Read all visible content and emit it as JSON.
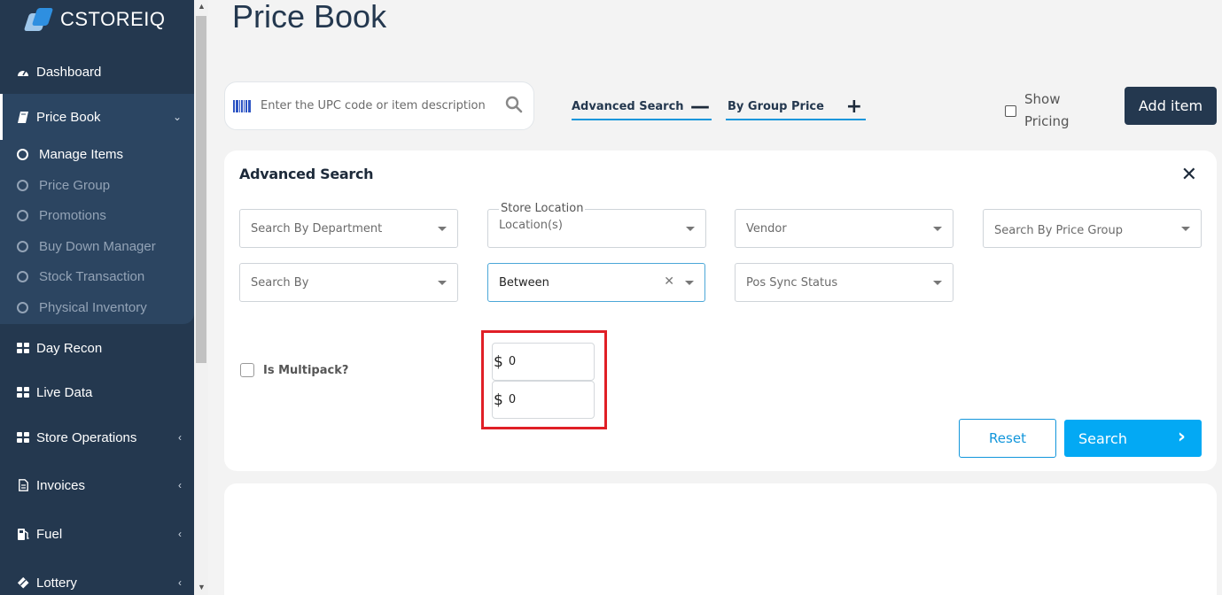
{
  "brand": {
    "name": "CSTOREIQ"
  },
  "sidebar": {
    "items": [
      {
        "label": "Dashboard"
      },
      {
        "label": "Price Book"
      },
      {
        "label": "Day Recon"
      },
      {
        "label": "Live Data"
      },
      {
        "label": "Store Operations"
      },
      {
        "label": "Invoices"
      },
      {
        "label": "Fuel"
      },
      {
        "label": "Lottery"
      }
    ],
    "price_book_sub": [
      {
        "label": "Manage Items"
      },
      {
        "label": "Price Group"
      },
      {
        "label": "Promotions"
      },
      {
        "label": "Buy Down Manager"
      },
      {
        "label": "Stock Transaction"
      },
      {
        "label": "Physical Inventory"
      }
    ]
  },
  "page": {
    "title": "Price Book"
  },
  "toolbar": {
    "search_placeholder": "Enter the UPC code or item description",
    "advanced_search_label": "Advanced Search",
    "advanced_search_symbol": "—",
    "group_price_label": "By Group Price",
    "group_price_symbol": "+",
    "show_pricing_label": "Show Pricing",
    "add_item_label": "Add item"
  },
  "advanced_panel": {
    "title": "Advanced Search",
    "close_symbol": "✕",
    "department_placeholder": "Search By Department",
    "store_location_legend": "Store Location",
    "store_location_value": "Location(s)",
    "vendor_placeholder": "Vendor",
    "price_group_placeholder": "Search By Price Group",
    "search_by_placeholder": "Search By",
    "range_value": "Between",
    "clear_symbol": "✕",
    "pos_sync_placeholder": "Pos Sync Status",
    "multipack_label": "Is Multipack?",
    "price_from": {
      "currency": "$",
      "value": "0"
    },
    "price_to": {
      "currency": "$",
      "value": "0"
    },
    "reset_label": "Reset",
    "search_label": "Search",
    "search_arrow": "›"
  }
}
